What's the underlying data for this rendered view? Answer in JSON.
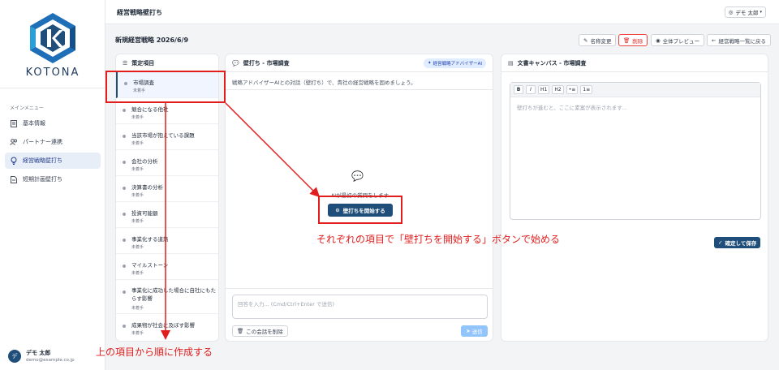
{
  "app": {
    "brand": "KOTONA",
    "page_title": "経営戦略壁打ち",
    "user_menu": "デモ 太郎"
  },
  "sidebar": {
    "section_label": "メインメニュー",
    "items": [
      {
        "label": "基本情報",
        "icon": "document-icon"
      },
      {
        "label": "パートナー連携",
        "icon": "users-icon"
      },
      {
        "label": "経営戦略壁打ち",
        "icon": "lightbulb-icon",
        "active": true
      },
      {
        "label": "短期計画壁打ち",
        "icon": "file-icon"
      }
    ],
    "user": {
      "name": "デモ 太郎",
      "email": "demo@example.co.jp",
      "initial": "デ"
    }
  },
  "session": {
    "title": "新規経営戦略 2026/6/9",
    "actions": {
      "rename": "名称変更",
      "delete": "削除",
      "preview": "全体プレビュー",
      "back": "経営戦略一覧に戻る"
    }
  },
  "items_panel": {
    "title": "策定項目",
    "items": [
      {
        "label": "市場調査",
        "status": "未着手"
      },
      {
        "label": "競合になる他社",
        "status": "未着手"
      },
      {
        "label": "当該市場が抱えている課題",
        "status": "未着手"
      },
      {
        "label": "会社の分析",
        "status": "未着手"
      },
      {
        "label": "決算書の分析",
        "status": "未着手"
      },
      {
        "label": "投資可能額",
        "status": "未着手"
      },
      {
        "label": "事業化する道筋",
        "status": "未着手"
      },
      {
        "label": "マイルストーン",
        "status": "未着手"
      },
      {
        "label": "事業化に成功した場合に自社にもたらす影響",
        "status": "未着手"
      },
      {
        "label": "成果物が社会に及ぼす影響",
        "status": "未着手"
      }
    ]
  },
  "chat_panel": {
    "title": "壁打ち - 市場調査",
    "badge": "経営戦略アドバイザーAI",
    "intro": "戦略アドバイザーAIとの対話（壁打ち）で、貴社の経営戦略を固めましょう。",
    "hint": "AIが最初の質問をします",
    "start_button": "壁打ちを開始する",
    "input_placeholder": "回答を入力... (Cmd/Ctrl+Enter で送信)",
    "clear_button": "この会話を削除",
    "send_button": "送信"
  },
  "canvas_panel": {
    "title": "文書キャンバス - 市場調査",
    "toolbar": [
      "B",
      "I",
      "H1",
      "H2",
      "•≡",
      "1≡"
    ],
    "placeholder": "壁打ちが進むと、ここに素案が表示されます...",
    "save_button": "確定して保存"
  },
  "annotations": {
    "start_note": "それぞれの項目で「壁打ちを開始する」ボタンで始める",
    "order_note": "上の項目から順に作成する",
    "color": "#e11d1d"
  }
}
